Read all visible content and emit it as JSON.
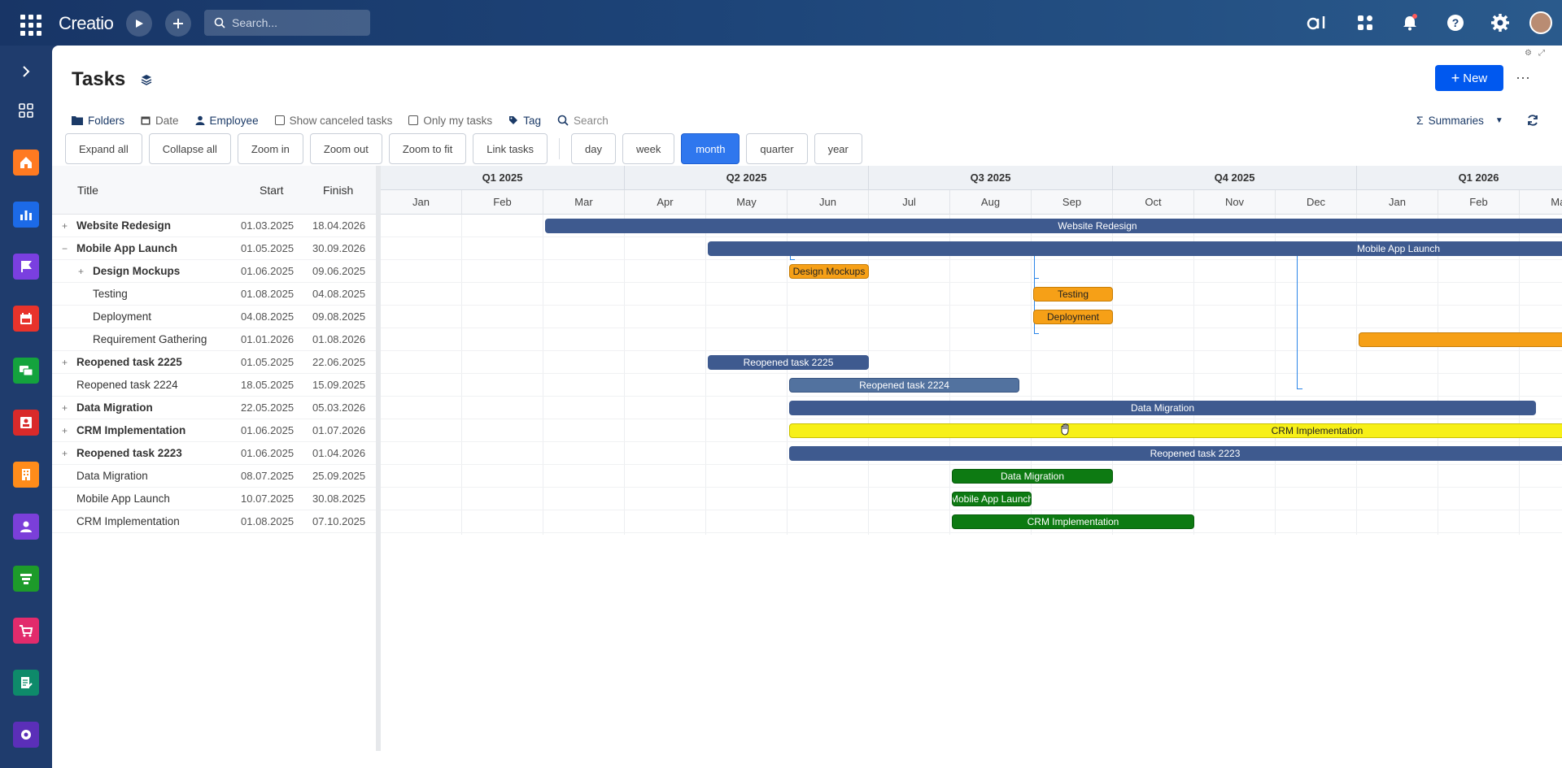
{
  "app": {
    "logo": "Creatio",
    "search_placeholder": "Search..."
  },
  "top_icons": [
    "ai-icon",
    "apps-icon",
    "notifications-icon",
    "help-icon",
    "settings-icon"
  ],
  "page": {
    "title": "Tasks",
    "new_label": "New",
    "more_label": "⋯"
  },
  "filters": {
    "folders": "Folders",
    "date": "Date",
    "employee": "Employee",
    "show_canceled": "Show canceled tasks",
    "only_my": "Only my tasks",
    "tag": "Tag",
    "search_placeholder": "Search",
    "summaries": "Summaries"
  },
  "toolbar": {
    "expand_all": "Expand all",
    "collapse_all": "Collapse all",
    "zoom_in": "Zoom in",
    "zoom_out": "Zoom out",
    "zoom_to_fit": "Zoom to fit",
    "link_tasks": "Link tasks",
    "scales": [
      {
        "label": "day",
        "active": false
      },
      {
        "label": "week",
        "active": false
      },
      {
        "label": "month",
        "active": true
      },
      {
        "label": "quarter",
        "active": false
      },
      {
        "label": "year",
        "active": false
      }
    ]
  },
  "grid": {
    "columns": {
      "title": "Title",
      "start": "Start",
      "finish": "Finish"
    },
    "rows": [
      {
        "title": "Website Redesign",
        "start": "01.03.2025",
        "finish": "18.04.2026",
        "expander": "+",
        "bold": true,
        "level": 0
      },
      {
        "title": "Mobile App Launch",
        "start": "01.05.2025",
        "finish": "30.09.2026",
        "expander": "−",
        "bold": true,
        "level": 0
      },
      {
        "title": "Design Mockups",
        "start": "01.06.2025",
        "finish": "09.06.2025",
        "expander": "+",
        "bold": true,
        "level": 1
      },
      {
        "title": "Testing",
        "start": "01.08.2025",
        "finish": "04.08.2025",
        "expander": "",
        "bold": false,
        "level": 1
      },
      {
        "title": "Deployment",
        "start": "04.08.2025",
        "finish": "09.08.2025",
        "expander": "",
        "bold": false,
        "level": 1
      },
      {
        "title": "Requirement Gathering",
        "start": "01.01.2026",
        "finish": "01.08.2026",
        "expander": "",
        "bold": false,
        "level": 1
      },
      {
        "title": "Reopened task 2225",
        "start": "01.05.2025",
        "finish": "22.06.2025",
        "expander": "+",
        "bold": true,
        "level": 0
      },
      {
        "title": "Reopened task 2224",
        "start": "18.05.2025",
        "finish": "15.09.2025",
        "expander": "",
        "bold": false,
        "level": 0
      },
      {
        "title": "Data Migration",
        "start": "22.05.2025",
        "finish": "05.03.2026",
        "expander": "+",
        "bold": true,
        "level": 0
      },
      {
        "title": "CRM Implementation",
        "start": "01.06.2025",
        "finish": "01.07.2026",
        "expander": "+",
        "bold": true,
        "level": 0
      },
      {
        "title": "Reopened task 2223",
        "start": "01.06.2025",
        "finish": "01.04.2026",
        "expander": "+",
        "bold": true,
        "level": 0
      },
      {
        "title": "Data Migration",
        "start": "08.07.2025",
        "finish": "25.09.2025",
        "expander": "",
        "bold": false,
        "level": 0
      },
      {
        "title": "Mobile App Launch",
        "start": "10.07.2025",
        "finish": "30.08.2025",
        "expander": "",
        "bold": false,
        "level": 0
      },
      {
        "title": "CRM Implementation",
        "start": "01.08.2025",
        "finish": "07.10.2025",
        "expander": "",
        "bold": false,
        "level": 0
      }
    ]
  },
  "timeline": {
    "quarters": [
      "Q1 2025",
      "Q2 2025",
      "Q3 2025",
      "Q4 2025",
      "Q1 2026"
    ],
    "months": [
      "Jan",
      "Feb",
      "Mar",
      "Apr",
      "May",
      "Jun",
      "Jul",
      "Aug",
      "Sep",
      "Oct",
      "Nov",
      "Dec",
      "Jan",
      "Feb",
      "Mar"
    ],
    "bars": [
      {
        "row": 0,
        "label": "Website Redesign",
        "start_month": 2.0,
        "end_month": 15.6,
        "color": "blue"
      },
      {
        "row": 1,
        "label": "Mobile App Launch",
        "start_month": 4.0,
        "end_month": 21.0,
        "color": "blue"
      },
      {
        "row": 2,
        "label": "Design Mockups",
        "start_month": 5.0,
        "end_month": 6.0,
        "color": "orange"
      },
      {
        "row": 3,
        "label": "Testing",
        "start_month": 8.0,
        "end_month": 9.0,
        "color": "orange"
      },
      {
        "row": 4,
        "label": "Deployment",
        "start_month": 8.0,
        "end_month": 9.0,
        "color": "orange"
      },
      {
        "row": 5,
        "label": "",
        "start_month": 12.0,
        "end_month": 19.0,
        "color": "orange"
      },
      {
        "row": 6,
        "label": "Reopened task 2225",
        "start_month": 4.0,
        "end_month": 6.0,
        "color": "blue"
      },
      {
        "row": 7,
        "label": "Reopened task 2224",
        "start_month": 5.0,
        "end_month": 7.85,
        "color": "sel"
      },
      {
        "row": 8,
        "label": "Data Migration",
        "start_month": 5.0,
        "end_month": 14.2,
        "color": "blue"
      },
      {
        "row": 9,
        "label": "CRM Implementation",
        "start_month": 5.0,
        "end_month": 18.0,
        "color": "yellow"
      },
      {
        "row": 10,
        "label": "Reopened task 2223",
        "start_month": 5.0,
        "end_month": 15.0,
        "color": "blue"
      },
      {
        "row": 11,
        "label": "Data Migration",
        "start_month": 7.0,
        "end_month": 9.0,
        "color": "green"
      },
      {
        "row": 12,
        "label": "Mobile App Launch",
        "start_month": 7.0,
        "end_month": 8.0,
        "color": "green"
      },
      {
        "row": 13,
        "label": "CRM Implementation",
        "start_month": 7.0,
        "end_month": 10.0,
        "color": "green"
      }
    ]
  },
  "colors": {
    "accent": "#0058ef",
    "bar_blue": "#3e5a8f",
    "bar_orange": "#f6a017",
    "bar_yellow": "#f7f018",
    "bar_green": "#0d7a12"
  }
}
